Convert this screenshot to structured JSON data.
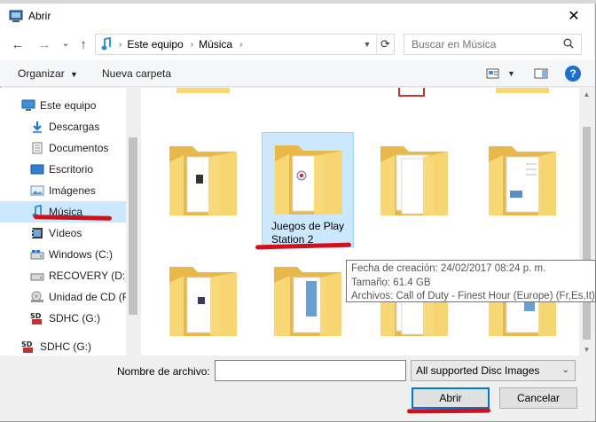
{
  "window": {
    "title": "Abrir",
    "close_glyph": "✕"
  },
  "nav": {
    "back_glyph": "←",
    "forward_glyph": "→",
    "history_glyph": "⌄",
    "up_glyph": "↑",
    "breadcrumb": [
      "Este equipo",
      "Música"
    ],
    "crumb_sep": "›",
    "search_placeholder": "Buscar en Música"
  },
  "toolbar": {
    "organize_label": "Organizar",
    "new_folder_label": "Nueva carpeta",
    "help_glyph": "?"
  },
  "sidebar": {
    "items": [
      {
        "label": "Este equipo",
        "icon": "pc-icon"
      },
      {
        "label": "Descargas",
        "icon": "downloads-icon"
      },
      {
        "label": "Documentos",
        "icon": "documents-icon"
      },
      {
        "label": "Escritorio",
        "icon": "desktop-icon"
      },
      {
        "label": "Imágenes",
        "icon": "images-icon"
      },
      {
        "label": "Música",
        "icon": "music-icon",
        "selected": true
      },
      {
        "label": "Vídeos",
        "icon": "videos-icon"
      },
      {
        "label": "Windows (C:)",
        "icon": "drive-icon"
      },
      {
        "label": "RECOVERY (D:)",
        "icon": "drive-icon"
      },
      {
        "label": "Unidad de CD (F",
        "icon": "cd-drive-icon"
      },
      {
        "label": "SDHC (G:)",
        "icon": "sd-card-icon"
      },
      {
        "label": "SDHC (G:)",
        "icon": "sd-card-icon"
      }
    ]
  },
  "content": {
    "folders": [
      {
        "label": "",
        "variant": "disc"
      },
      {
        "label": "Juegos de Play Station 2",
        "variant": "disc",
        "selected": true
      },
      {
        "label": "",
        "variant": "docs"
      },
      {
        "label": "",
        "variant": "docs-blue"
      },
      {
        "label": "",
        "variant": "disc"
      },
      {
        "label": "",
        "variant": "docs-blue"
      },
      {
        "label": "",
        "variant": "docs"
      },
      {
        "label": "",
        "variant": "docs-blue"
      }
    ]
  },
  "tooltip": {
    "line1": "Fecha de creación: 24/02/2017 08:24 p. m.",
    "line2": "Tamaño: 61.4 GB",
    "line3": "Archivos: Call of Duty - Finest Hour (Europe) (Fr,Es,It)"
  },
  "footer": {
    "filename_label": "Nombre de archivo:",
    "filename_value": "",
    "filter_value": "All supported Disc Images",
    "open_label": "Abrir",
    "cancel_label": "Cancelar"
  },
  "colors": {
    "selection": "#cce8ff",
    "accent": "#0078d7",
    "annotation": "#d0101a",
    "folder": "#f8d775"
  }
}
